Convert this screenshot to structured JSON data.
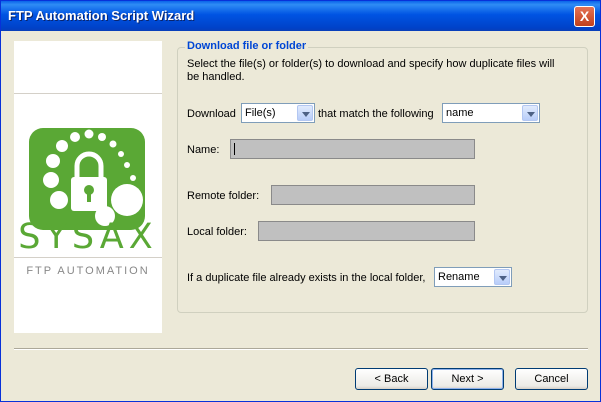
{
  "window": {
    "title": "FTP Automation Script Wizard",
    "close_label": "X"
  },
  "logo": {
    "word": "SYSAX",
    "subtitle": "FTP AUTOMATION"
  },
  "group": {
    "title": "Download file or folder",
    "description": "Select the file(s) or folder(s) to download and specify how duplicate files will be handled."
  },
  "download_row": {
    "label": "Download",
    "type_value": "File(s)",
    "middle_text": "that match the following",
    "match_value": "name"
  },
  "fields": {
    "name_label": "Name:",
    "remote_label": "Remote folder:",
    "local_label": "Local folder:"
  },
  "duplicate": {
    "label": "If a duplicate file already exists in the local folder,",
    "value": "Rename"
  },
  "buttons": {
    "back": "< Back",
    "next": "Next >",
    "cancel": "Cancel"
  },
  "colors": {
    "brand_green": "#5aa835",
    "title_blue": "#0046d5"
  }
}
